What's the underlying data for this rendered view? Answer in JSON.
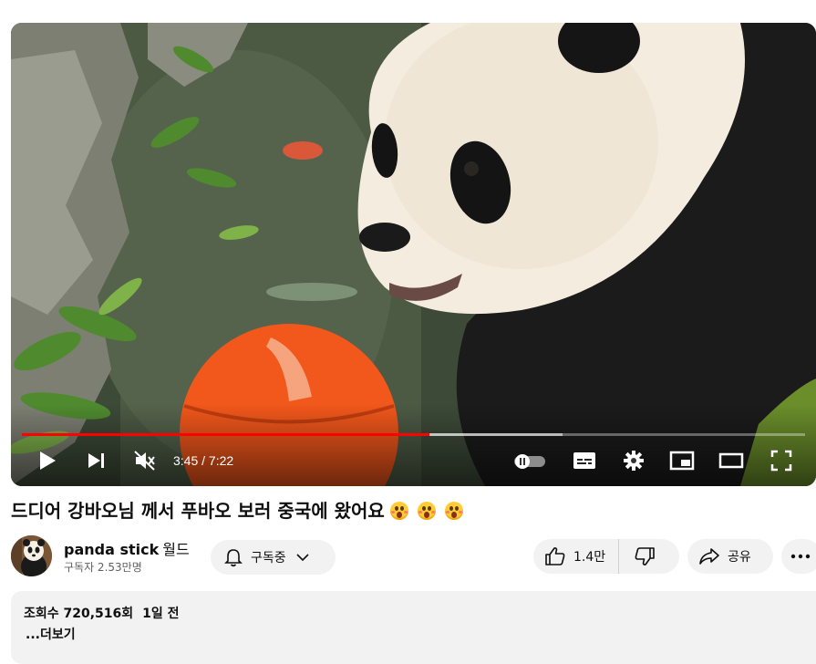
{
  "player": {
    "time_current": "3:45",
    "time_separator": " / ",
    "time_total": "7:22",
    "progress_fraction": 0.52,
    "buffered_fraction": 0.69,
    "accent_color": "#ff0000",
    "controls": [
      {
        "name": "play-icon"
      },
      {
        "name": "next-icon"
      },
      {
        "name": "mute-icon"
      },
      {
        "name": "autoplay-toggle"
      },
      {
        "name": "subtitles-icon"
      },
      {
        "name": "settings-gear-icon"
      },
      {
        "name": "miniplayer-icon"
      },
      {
        "name": "theater-mode-icon"
      },
      {
        "name": "fullscreen-icon"
      }
    ]
  },
  "video": {
    "title": "드디어 강바오님 께서 푸바오 보러 중국에 왔어요",
    "title_emojis": [
      "astonished-emoji",
      "astonished-emoji",
      "astonished-emoji"
    ]
  },
  "channel": {
    "name": "panda stick",
    "name_suffix": "월드",
    "subscribers": "구독자 2.53만명"
  },
  "actions": {
    "subscribe_label": "구독중",
    "like_count": "1.4만",
    "share_label": "공유"
  },
  "description": {
    "views": "조회수 720,516회",
    "date": "1일 전",
    "more_label": "...더보기"
  }
}
